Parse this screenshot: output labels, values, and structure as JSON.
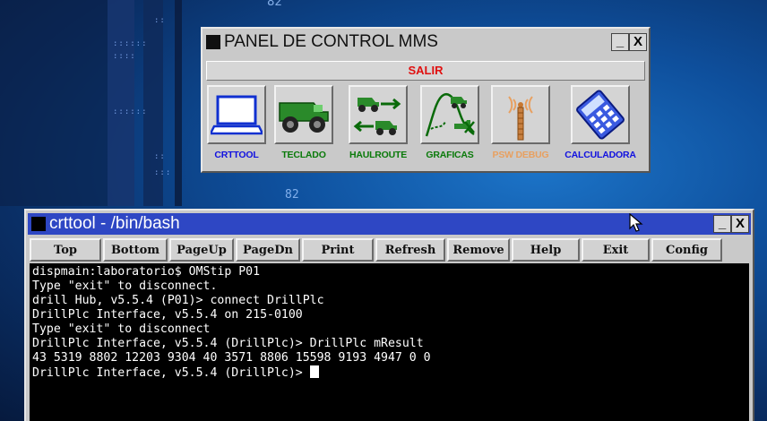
{
  "panel": {
    "title": "PANEL DE CONTROL MMS",
    "minimize_label": "_",
    "close_label": "X",
    "salir_label": "SALIR",
    "tools": [
      {
        "label": "CRTTOOL",
        "icon": "laptop-icon",
        "color": "#1010e0"
      },
      {
        "label": "TECLADO",
        "icon": "haul-truck-icon",
        "color": "#0a7a0a"
      },
      {
        "label": "HAULROUTE",
        "icon": "haul-route-icon",
        "color": "#0a7a0a"
      },
      {
        "label": "GRAFICAS",
        "icon": "graph-route-icon",
        "color": "#0a7a0a"
      },
      {
        "label": "PSW DEBUG",
        "icon": "antenna-icon",
        "color": "#e8a060"
      },
      {
        "label": "CALCULADORA",
        "icon": "calculator-icon",
        "color": "#1010e0"
      }
    ]
  },
  "terminal": {
    "title": "crttool - /bin/bash",
    "minimize_label": "_",
    "close_label": "X",
    "toolbar": [
      "Top",
      "Bottom",
      "PageUp",
      "PageDn",
      "Print",
      "Refresh",
      "Remove",
      "Help",
      "Exit",
      "Config"
    ],
    "lines": [
      "dispmain:laboratorio$ OMStip P01",
      "Type \"exit\" to disconnect.",
      "drill Hub, v5.5.4 (P01)> connect DrillPlc",
      "DrillPlc Interface, v5.5.4 on 215-0100",
      "Type \"exit\" to disconnect",
      "DrillPlc Interface, v5.5.4 (DrillPlc)> DrillPlc mResult",
      "43 5319 8802 12203 9304 40 3571 8806 15598 9193 4947 0 0",
      "DrillPlc Interface, v5.5.4 (DrillPlc)> "
    ]
  },
  "background": {
    "marks": [
      "82",
      "82"
    ]
  }
}
